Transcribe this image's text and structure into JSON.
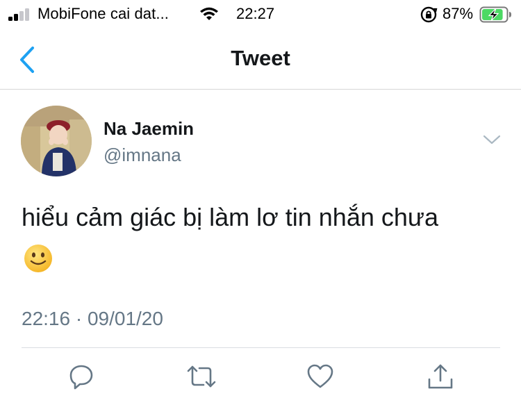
{
  "status_bar": {
    "carrier": "MobiFone cai dat...",
    "time": "22:27",
    "battery_percent": "87%",
    "battery_level": 0.87,
    "battery_color": "#4cd964"
  },
  "nav": {
    "title": "Tweet",
    "back_icon": "chevron-left-icon"
  },
  "tweet": {
    "author_name": "Na Jaemin",
    "author_handle": "@imnana",
    "text": "hiểu cảm giác bị làm lơ tin nhắn chưa",
    "emoji": "slightly-smiling-face",
    "timestamp": "22:16 · 09/01/20",
    "actions": [
      "reply-icon",
      "retweet-icon",
      "like-icon",
      "share-icon"
    ]
  },
  "colors": {
    "accent": "#1da1f2",
    "secondary_text": "#657786",
    "icon_gray": "#657786"
  }
}
